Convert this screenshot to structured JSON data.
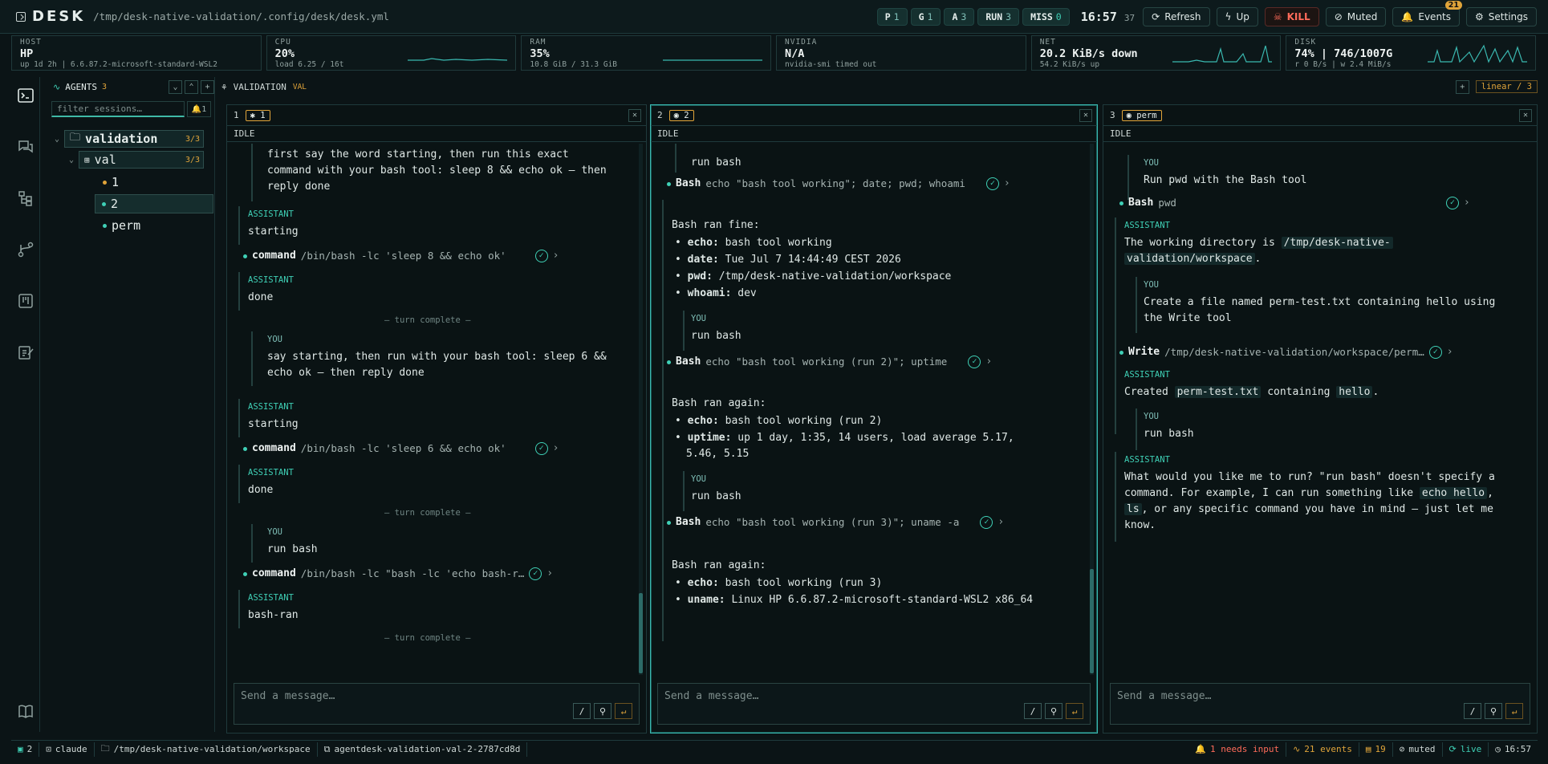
{
  "app": {
    "brand": "DESK",
    "path": "/tmp/desk-native-validation/.config/desk/desk.yml"
  },
  "topbar": {
    "pills": [
      {
        "label": "P",
        "n": "1"
      },
      {
        "label": "G",
        "n": "1"
      },
      {
        "label": "A",
        "n": "3"
      },
      {
        "label": "RUN",
        "n": "3"
      },
      {
        "label": "MISS",
        "n": "0"
      }
    ],
    "clock": "16:57",
    "seconds": "37",
    "refresh": "Refresh",
    "up": "Up",
    "kill": "KILL",
    "muted": "Muted",
    "events": "Events",
    "events_badge": "21",
    "settings": "Settings"
  },
  "metrics": [
    {
      "label": "HOST",
      "value": "HP",
      "sub": "up 1d 2h | 6.6.87.2-microsoft-standard-WSL2"
    },
    {
      "label": "CPU",
      "value": "20%",
      "sub": "load 6.25 / 16t"
    },
    {
      "label": "RAM",
      "value": "35%",
      "sub": "10.8 GiB / 31.3 GiB"
    },
    {
      "label": "NVIDIA",
      "value": "N/A",
      "sub": "nvidia-smi timed out"
    },
    {
      "label": "NET",
      "value": "20.2 KiB/s down",
      "sub": "54.2 KiB/s up"
    },
    {
      "label": "DISK",
      "value": "74% | 746/1007G",
      "sub": "r 0 B/s | w 2.4 MiB/s"
    }
  ],
  "sidebar": {
    "title": "AGENTS",
    "count": "3",
    "filter_placeholder": "filter sessions…",
    "filter_btn": "1",
    "group": {
      "label": "validation",
      "count": "3/3"
    },
    "sub": {
      "label": "val",
      "count": "3/3"
    },
    "items": [
      {
        "label": "1"
      },
      {
        "label": "2"
      },
      {
        "label": "perm"
      }
    ]
  },
  "workspace": {
    "title": "VALIDATION",
    "tag": "VAL",
    "layout": "linear / 3"
  },
  "panes": [
    {
      "index": "1",
      "chip": "1",
      "status": "IDLE",
      "you1_text": "first say the word starting, then run this exact\ncommand with your bash tool: sleep 8 && echo ok — then\nreply done",
      "assistant_label": "ASSISTANT",
      "you_label": "YOU",
      "a1": "starting",
      "t1": {
        "name": "command",
        "arg": "/bin/bash -lc 'sleep 8 && echo ok'"
      },
      "a2": "done",
      "turn": "— turn complete —",
      "you2_text": "say starting, then run with your bash tool: sleep 6 &&\necho ok — then reply done",
      "a3": "starting",
      "t2": {
        "name": "command",
        "arg": "/bin/bash -lc 'sleep 6 && echo ok'"
      },
      "a4": "done",
      "you3_text": "run bash",
      "t3": {
        "name": "command",
        "arg": "/bin/bash -lc \"bash -lc 'echo bash-r…"
      },
      "a5": "bash-ran",
      "composer": "Send a message…"
    },
    {
      "index": "2",
      "chip": "2",
      "status": "IDLE",
      "you_top": "run bash",
      "t1": {
        "name": "Bash",
        "arg": "echo \"bash tool working\"; date; pwd; whoami"
      },
      "a1_head": "Bash ran fine:",
      "a1_items": [
        {
          "k": "echo:",
          "v": "bash tool working"
        },
        {
          "k": "date:",
          "v": "Tue Jul 7 14:44:49 CEST 2026"
        },
        {
          "k": "pwd:",
          "v": "/tmp/desk-native-validation/workspace"
        },
        {
          "k": "whoami:",
          "v": "dev"
        }
      ],
      "you2": "run bash",
      "t2": {
        "name": "Bash",
        "arg": "echo \"bash tool working (run 2)\"; uptime"
      },
      "a2_head": "Bash ran again:",
      "a2_items": [
        {
          "k": "echo:",
          "v": "bash tool working (run 2)"
        },
        {
          "k": "uptime:",
          "v": "up 1 day, 1:35, 14 users, load average 5.17,"
        },
        {
          "k": "",
          "v": "5.46, 5.15"
        }
      ],
      "you3": "run bash",
      "t3": {
        "name": "Bash",
        "arg": "echo \"bash tool working (run 3)\"; uname -a"
      },
      "a3_head": "Bash ran again:",
      "a3_items": [
        {
          "k": "echo:",
          "v": "bash tool working (run 3)"
        },
        {
          "k": "uname:",
          "v": "Linux HP 6.6.87.2-microsoft-standard-WSL2 x86_64"
        }
      ],
      "composer": "Send a message…"
    },
    {
      "index": "3",
      "chip": "perm",
      "status": "IDLE",
      "you1": "Run pwd with the Bash tool",
      "t1": {
        "name": "Bash",
        "arg": "pwd"
      },
      "a1_pre": "The working directory is ",
      "a1_code1": "/tmp/desk-native-",
      "a1_code2": "validation/workspace",
      "a1_post": ".",
      "you2": "Create a file named perm-test.txt containing hello using\nthe Write tool",
      "t2": {
        "name": "Write",
        "arg": "/tmp/desk-native-validation/workspace/perm…"
      },
      "a2_pre": "Created ",
      "a2_code1": "perm-test.txt",
      "a2_mid": " containing ",
      "a2_code2": "hello",
      "a2_post": ".",
      "you3": "run bash",
      "a3_l1": "What would you like me to run? \"run bash\" doesn't specify a",
      "a3_l2_pre": "command. For example, I can run something like ",
      "a3_code1": "echo hello",
      "a3_l2_post": ",",
      "a3_code2": "ls",
      "a3_l3": ", or any specific command you have in mind — just let me",
      "a3_l4": "know.",
      "composer": "Send a message…"
    }
  ],
  "statusbar": {
    "session": "2",
    "agent": "claude",
    "cwd": "/tmp/desk-native-validation/workspace",
    "id": "agentdesk-validation-val-2-2787cd8d",
    "needs": "1 needs input",
    "events": "21 events",
    "msgs": "19",
    "muted": "muted",
    "live": "live",
    "time": "16:57"
  },
  "colors": {
    "accent": "#3fd0b6",
    "amber": "#e0a43a",
    "danger": "#ff6b5a",
    "bg": "#0b1416"
  }
}
